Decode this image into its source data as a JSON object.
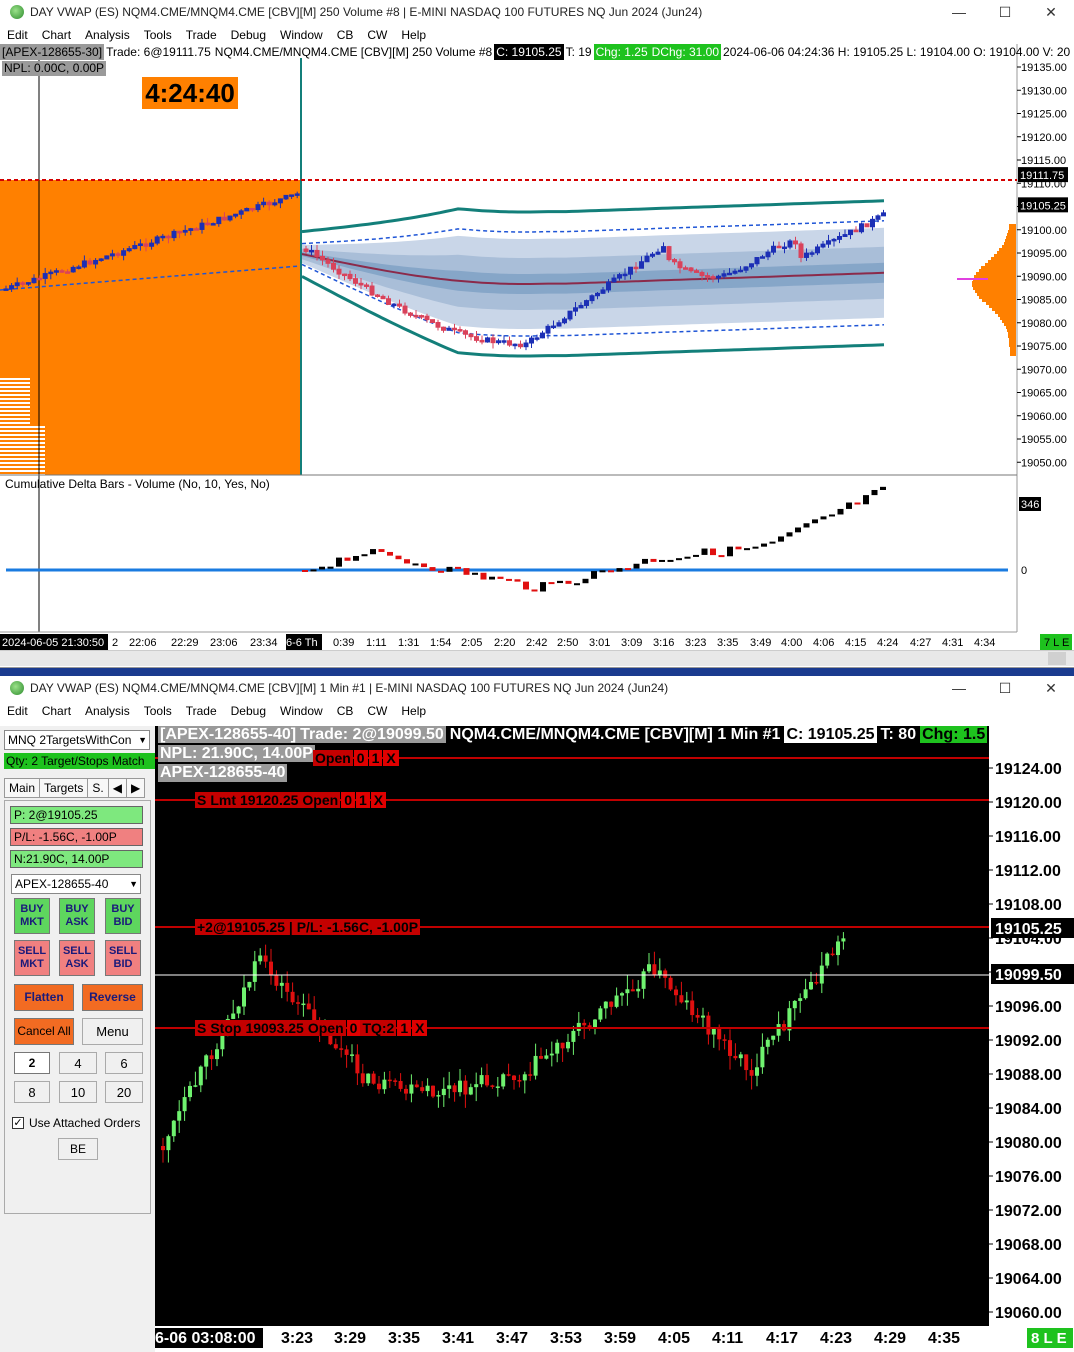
{
  "window1": {
    "title": "DAY VWAP (ES) NQM4.CME/MNQM4.CME [CBV][M]  250 Volume #8 | E-MINI NASDAQ 100 FUTURES NQ Jun 2024 (Jun24)",
    "menu": [
      "Edit",
      "Chart",
      "Analysis",
      "Tools",
      "Trade",
      "Debug",
      "Window",
      "CB",
      "CW",
      "Help"
    ],
    "info": {
      "account": "[APEX-128655-30]",
      "trade": "Trade: 6@19111.75",
      "symbol": "NQM4.CME/MNQM4.CME [CBV][M]  250 Volume #8",
      "close": "C: 19105.25",
      "ticks": "T: 19",
      "chg": "Chg: 1.25",
      "dchg": "DChg: 31.00",
      "rest": "2024-06-06 04:24:36  H: 19105.25  L: 19104.00  O: 19104.00  V: 20",
      "npl": "NPL: 0.00C, 0.00P"
    },
    "clock": "4:24:40",
    "price_axis": [
      "19135.00",
      "19130.00",
      "19125.00",
      "19120.00",
      "19115.00",
      "19110.00",
      "19105.00",
      "19100.00",
      "19095.00",
      "19090.00",
      "19085.00",
      "19080.00",
      "19075.00",
      "19070.00",
      "19065.00",
      "19060.00",
      "19055.00",
      "19050.00"
    ],
    "price_marker_red": "19111.75",
    "price_marker_last": "19105.25",
    "subgraph_title": "Cumulative Delta Bars - Volume   (No, 10, Yes, No)",
    "subgraph_value": "346",
    "subgraph_zero": "0",
    "time_start": "2024-06-05  21:30:50",
    "time_labels": [
      "2",
      "22:06",
      "22:29",
      "23:06",
      "23:34",
      "6-6  Th",
      "0:39",
      "1:11",
      "1:31",
      "1:54",
      "2:05",
      "2:20",
      "2:42",
      "2:50",
      "3:01",
      "3:09",
      "3:16",
      "3:23",
      "3:35",
      "3:49",
      "4:00",
      "4:06",
      "4:15",
      "4:24",
      "4:27",
      "4:31",
      "4:34"
    ],
    "status_tag": "7 L E",
    "colors": {
      "profile": "#ff8000",
      "band_outer": "#137f7a",
      "vwap": "#8b2a4a",
      "bull": "#1c2fb5",
      "bear": "#d9425b",
      "clock_bg": "#ff8000"
    }
  },
  "window2": {
    "title": "DAY VWAP (ES) NQM4.CME/MNQM4.CME [CBV][M]  1 Min  #1 | E-MINI NASDAQ 100 FUTURES NQ Jun 2024 (Jun24)",
    "menu": [
      "Edit",
      "Chart",
      "Analysis",
      "Tools",
      "Trade",
      "Debug",
      "Window",
      "CB",
      "CW",
      "Help"
    ],
    "dom": {
      "strategy": "MNQ 2TargetsWithCon",
      "qty_status": "Qty: 2 Target/Stops Match",
      "tabs": [
        "Main",
        "Targets",
        "S."
      ],
      "position": "P: 2@19105.25",
      "pl": "P/L: -1.56C, -1.00P",
      "npl": "N:21.90C, 14.00P",
      "account": "APEX-128655-40",
      "buy_mkt": "BUY\nMKT",
      "buy_ask": "BUY\nASK",
      "buy_bid": "BUY\nBID",
      "sell_mkt": "SELL\nMKT",
      "sell_ask": "SELL\nASK",
      "sell_bid": "SELL\nBID",
      "flatten": "Flatten",
      "reverse": "Reverse",
      "cancel_all": "Cancel All",
      "menu": "Menu",
      "qty_buttons": [
        "2",
        "4",
        "6",
        "8",
        "10",
        "20"
      ],
      "attached_orders_label": "Use Attached Orders",
      "attached_orders_checked": true,
      "be": "BE"
    },
    "info": {
      "account": "[APEX-128655-40]",
      "trade": "Trade: 2@19099.50",
      "symbol": "NQM4.CME/MNQM4.CME [CBV][M]  1 Min  #1",
      "close": "C: 19105.25",
      "ticks": "T: 80",
      "chg": "Chg: 1.5",
      "npl": "NPL: 21.90C, 14.00P",
      "account2": "APEX-128655-40"
    },
    "orders": {
      "top_partial": [
        "Open",
        "0",
        "1",
        "X"
      ],
      "limit": [
        "S",
        "Lmt",
        "19120.25",
        "Open",
        "0",
        "1",
        "X"
      ],
      "position_line": "+2@19105.25 | P/L: -1.56C, -1.00P",
      "stop": [
        "S",
        "Stop",
        "19093.25",
        "Open",
        "0",
        "TQ:2",
        "1",
        "X"
      ]
    },
    "price_axis": [
      "19124.00",
      "19120.00",
      "19116.00",
      "19112.00",
      "19108.00",
      "19104.00",
      "19100.00",
      "19096.00",
      "19092.00",
      "19088.00",
      "19084.00",
      "19080.00",
      "19076.00",
      "19072.00",
      "19068.00",
      "19064.00",
      "19060.00"
    ],
    "price_marker_last": "19105.25",
    "price_marker_entry": "19099.50",
    "time_start": "6-06  03:08:00",
    "time_labels": [
      "3:23",
      "3:29",
      "3:35",
      "3:41",
      "3:47",
      "3:53",
      "3:59",
      "4:05",
      "4:11",
      "4:17",
      "4:23",
      "4:29",
      "4:35"
    ],
    "status_tag": "8 L E",
    "colors": {
      "bull": "#6ff26f",
      "bear": "#e01010",
      "order_line": "#c00000"
    }
  }
}
